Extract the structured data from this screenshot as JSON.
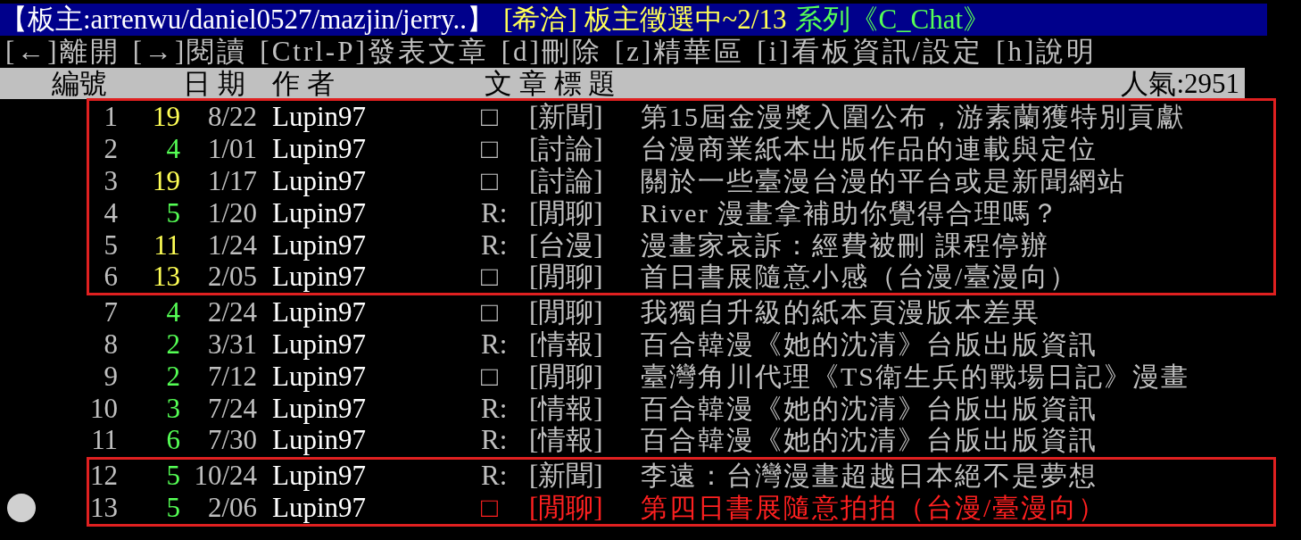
{
  "title_bar": {
    "moderators": "【板主:arrenwu/daniel0527/mazjin/jerry..】",
    "notice": "[希洽] 板主徵選中~2/13",
    "series": "系列《C_Chat》"
  },
  "menu": [
    "[←]離開",
    "[→]閱讀",
    "[Ctrl-P]發表文章",
    "[d]刪除",
    "[z]精華區",
    "[i]看板資訊/設定",
    "[h]說明"
  ],
  "columns": {
    "number": "編號",
    "date": "日 期",
    "author": "作  者",
    "title": "文  章  標  題",
    "popularity": "人氣:2951"
  },
  "sections": [
    {
      "highlighted": true,
      "rows": [
        {
          "number": "1",
          "count": {
            "text": "19",
            "color": "#ffff55"
          },
          "date": "8/22",
          "author": "Lupin97",
          "mark": "□",
          "tag": "[新聞]",
          "title": "第15屆金漫獎入圍公布，游素蘭獲特別貢獻",
          "color": "#c0c0c0",
          "selected": false
        },
        {
          "number": "2",
          "count": {
            "text": "4",
            "color": "#55ff55"
          },
          "date": "1/01",
          "author": "Lupin97",
          "mark": "□",
          "tag": "[討論]",
          "title": "台漫商業紙本出版作品的連載與定位",
          "color": "#c0c0c0",
          "selected": false
        },
        {
          "number": "3",
          "count": {
            "text": "19",
            "color": "#ffff55"
          },
          "date": "1/17",
          "author": "Lupin97",
          "mark": "□",
          "tag": "[討論]",
          "title": "關於一些臺漫台漫的平台或是新聞網站",
          "color": "#c0c0c0",
          "selected": false
        },
        {
          "number": "4",
          "count": {
            "text": "5",
            "color": "#55ff55"
          },
          "date": "1/20",
          "author": "Lupin97",
          "mark": "R:",
          "tag": "[閒聊]",
          "title": "River 漫畫拿補助你覺得合理嗎？",
          "color": "#c0c0c0",
          "selected": false
        },
        {
          "number": "5",
          "count": {
            "text": "11",
            "color": "#ffff55"
          },
          "date": "1/24",
          "author": "Lupin97",
          "mark": "R:",
          "tag": "[台漫]",
          "title": "漫畫家哀訴：經費被刪 課程停辦",
          "color": "#c0c0c0",
          "selected": false
        },
        {
          "number": "6",
          "count": {
            "text": "13",
            "color": "#ffff55"
          },
          "date": "2/05",
          "author": "Lupin97",
          "mark": "□",
          "tag": "[閒聊]",
          "title": "首日書展隨意小感（台漫/臺漫向）",
          "color": "#c0c0c0",
          "selected": false
        }
      ]
    },
    {
      "highlighted": false,
      "rows": [
        {
          "number": "7",
          "count": {
            "text": "4",
            "color": "#55ff55"
          },
          "date": "2/24",
          "author": "Lupin97",
          "mark": "□",
          "tag": "[閒聊]",
          "title": "我獨自升級的紙本頁漫版本差異",
          "color": "#c0c0c0",
          "selected": false
        },
        {
          "number": "8",
          "count": {
            "text": "2",
            "color": "#55ff55"
          },
          "date": "3/31",
          "author": "Lupin97",
          "mark": "R:",
          "tag": "[情報]",
          "title": "百合韓漫《她的沈清》台版出版資訊",
          "color": "#c0c0c0",
          "selected": false
        },
        {
          "number": "9",
          "count": {
            "text": "2",
            "color": "#55ff55"
          },
          "date": "7/12",
          "author": "Lupin97",
          "mark": "□",
          "tag": "[閒聊]",
          "title": "臺灣角川代理《TS衛生兵的戰場日記》漫畫",
          "color": "#c0c0c0",
          "selected": false
        },
        {
          "number": "10",
          "count": {
            "text": "3",
            "color": "#55ff55"
          },
          "date": "7/24",
          "author": "Lupin97",
          "mark": "R:",
          "tag": "[情報]",
          "title": "百合韓漫《她的沈清》台版出版資訊",
          "color": "#c0c0c0",
          "selected": false
        },
        {
          "number": "11",
          "count": {
            "text": "6",
            "color": "#55ff55"
          },
          "date": "7/30",
          "author": "Lupin97",
          "mark": "R:",
          "tag": "[情報]",
          "title": "百合韓漫《她的沈清》台版出版資訊",
          "color": "#c0c0c0",
          "selected": false
        }
      ]
    },
    {
      "highlighted": true,
      "rows": [
        {
          "number": "12",
          "count": {
            "text": "5",
            "color": "#55ff55"
          },
          "date": "10/24",
          "author": "Lupin97",
          "mark": "R:",
          "tag": "[新聞]",
          "title": "李遠：台灣漫畫超越日本絕不是夢想",
          "color": "#c0c0c0",
          "selected": false
        },
        {
          "number": "13",
          "count": {
            "text": "5",
            "color": "#55ff55"
          },
          "date": "2/06",
          "author": "Lupin97",
          "mark": "□",
          "tag": "[閒聊]",
          "title": "第四日書展隨意拍拍（台漫/臺漫向）",
          "color": "#ff2020",
          "selected": true
        }
      ]
    }
  ]
}
